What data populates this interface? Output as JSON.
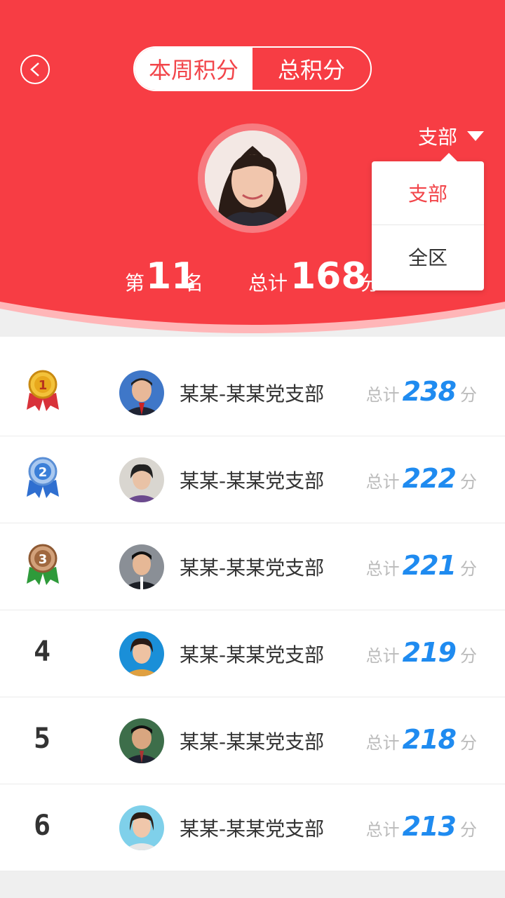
{
  "header": {
    "tabs": [
      "本周积分",
      "总积分"
    ],
    "active_tab": 0,
    "scope_label": "支部",
    "rank_prefix": "第",
    "rank_value": "11",
    "rank_suffix": "名",
    "total_prefix": "总计",
    "total_value": "168",
    "total_suffix": "分"
  },
  "scope_menu": {
    "items": [
      "支部",
      "全区"
    ],
    "selected": 0
  },
  "leaderboard": {
    "rows": [
      {
        "rank": "1",
        "name": "某某-某某党支部",
        "score_label": "总计",
        "score": "238",
        "unit": "分"
      },
      {
        "rank": "2",
        "name": "某某-某某党支部",
        "score_label": "总计",
        "score": "222",
        "unit": "分"
      },
      {
        "rank": "3",
        "name": "某某-某某党支部",
        "score_label": "总计",
        "score": "221",
        "unit": "分"
      },
      {
        "rank": "4",
        "name": "某某-某某党支部",
        "score_label": "总计",
        "score": "219",
        "unit": "分"
      },
      {
        "rank": "5",
        "name": "某某-某某党支部",
        "score_label": "总计",
        "score": "218",
        "unit": "分"
      },
      {
        "rank": "6",
        "name": "某某-某某党支部",
        "score_label": "总计",
        "score": "213",
        "unit": "分"
      }
    ]
  },
  "colors": {
    "header_red": "#f73d44",
    "accent_red": "#f2454a",
    "score_blue": "#1f8bf0",
    "gold": "#e8a81c",
    "silver": "#3b7fd8",
    "bronze": "#a0683f"
  }
}
